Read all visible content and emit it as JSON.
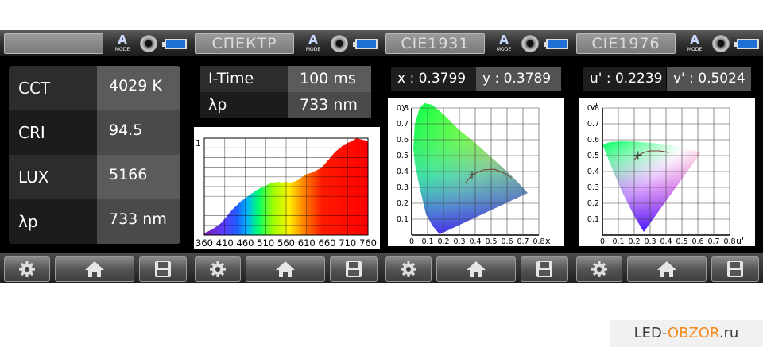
{
  "screens": [
    {
      "title": "",
      "mode_label": "MODE",
      "mode_letter": "A"
    },
    {
      "title": "СПЕКТР",
      "mode_label": "MODE",
      "mode_letter": "A"
    },
    {
      "title": "CIE1931",
      "mode_label": "MODE",
      "mode_letter": "A"
    },
    {
      "title": "CIE1976",
      "mode_label": "MODE",
      "mode_letter": "A"
    }
  ],
  "measurements": [
    {
      "label": "CCT",
      "value": "4029 K"
    },
    {
      "label": "CRI",
      "value": "94.5"
    },
    {
      "label": "LUX",
      "value": "5166"
    },
    {
      "label": "λp",
      "value": "733 nm"
    }
  ],
  "spectrum_info": [
    {
      "label": "I-Time",
      "value": "100 ms"
    },
    {
      "label": "λp",
      "value": "733 nm"
    }
  ],
  "cie1931": {
    "x_text": "x : 0.3799",
    "y_text": "y : 0.3789"
  },
  "cie1976": {
    "u_text": "u' : 0.2239",
    "v_text": "v' : 0.5024"
  },
  "chart_data": [
    {
      "type": "area",
      "title": "",
      "xlabel": "",
      "ylabel": "",
      "x_ticks": [
        "360",
        "410",
        "460",
        "510",
        "560",
        "610",
        "660",
        "710",
        "760"
      ],
      "y_ticks": [
        "1"
      ],
      "xlim": [
        360,
        760
      ],
      "ylim": [
        0,
        1
      ],
      "grid": true,
      "x": [
        360,
        380,
        400,
        410,
        420,
        430,
        440,
        450,
        460,
        470,
        480,
        490,
        500,
        510,
        520,
        530,
        540,
        550,
        560,
        570,
        580,
        590,
        600,
        610,
        620,
        630,
        640,
        650,
        660,
        670,
        680,
        690,
        700,
        710,
        720,
        733,
        740,
        750,
        760
      ],
      "values": [
        0.02,
        0.06,
        0.12,
        0.17,
        0.22,
        0.27,
        0.31,
        0.35,
        0.38,
        0.41,
        0.44,
        0.47,
        0.49,
        0.51,
        0.53,
        0.54,
        0.55,
        0.54,
        0.55,
        0.54,
        0.55,
        0.57,
        0.6,
        0.63,
        0.64,
        0.66,
        0.68,
        0.71,
        0.76,
        0.81,
        0.86,
        0.89,
        0.93,
        0.95,
        0.97,
        1.0,
        0.99,
        0.98,
        0.97
      ]
    },
    {
      "type": "scatter",
      "title": "CIE1931",
      "xlabel": "x",
      "ylabel": "y",
      "xlim": [
        0,
        0.8
      ],
      "ylim": [
        0,
        0.8
      ],
      "x_ticks": [
        "0",
        "0.1",
        "0.2",
        "0.3",
        "0.4",
        "0.5",
        "0.6",
        "0.7",
        "0.8"
      ],
      "y_ticks": [
        "0.1",
        "0.2",
        "0.3",
        "0.4",
        "0.5",
        "0.6",
        "0.7",
        "0.8"
      ],
      "grid": true,
      "points": [
        {
          "x": 0.3799,
          "y": 0.3789
        }
      ]
    },
    {
      "type": "scatter",
      "title": "CIE1976",
      "xlabel": "u'",
      "ylabel": "v'",
      "xlim": [
        0,
        0.8
      ],
      "ylim": [
        0,
        0.8
      ],
      "x_ticks": [
        "0",
        "0.1",
        "0.2",
        "0.3",
        "0.4",
        "0.5",
        "0.6",
        "0.7",
        "0.8"
      ],
      "y_ticks": [
        "0.1",
        "0.2",
        "0.3",
        "0.4",
        "0.5",
        "0.6",
        "0.7",
        "0.8"
      ],
      "grid": true,
      "points": [
        {
          "x": 0.2239,
          "y": 0.5024
        }
      ]
    }
  ],
  "watermark": {
    "part1": "LED-",
    "part2": "OBZOR",
    "part3": ".ru"
  },
  "colors": {
    "accent": "#f28a1c",
    "battery": "#1e6fd6",
    "panel_dark": "#2c2c2c",
    "panel_light": "#5b5b5b"
  }
}
